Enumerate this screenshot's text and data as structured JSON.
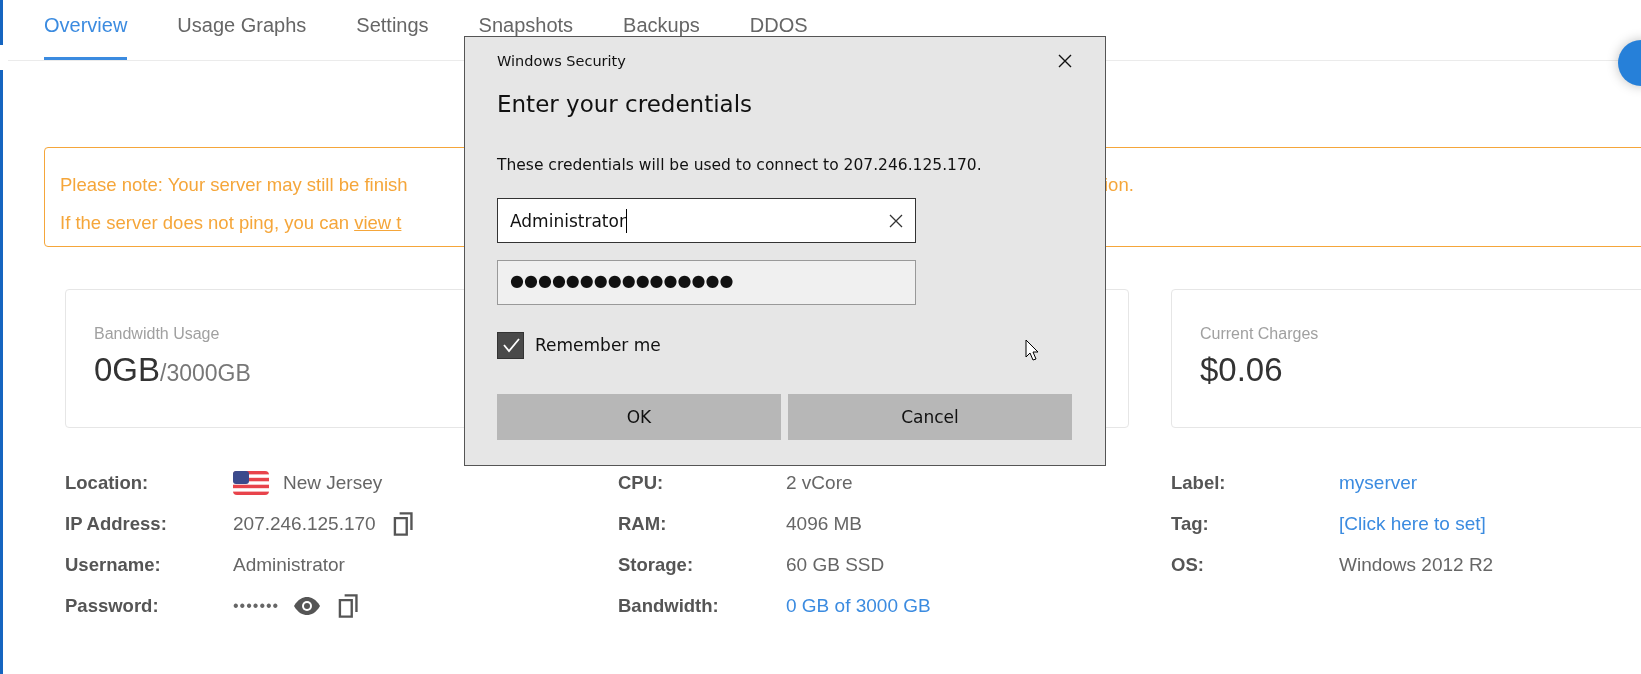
{
  "tabs": [
    {
      "label": "Overview",
      "selected": true
    },
    {
      "label": "Usage Graphs",
      "selected": false
    },
    {
      "label": "Settings",
      "selected": false
    },
    {
      "label": "Snapshots",
      "selected": false
    },
    {
      "label": "Backups",
      "selected": false
    },
    {
      "label": "DDOS",
      "selected": false
    }
  ],
  "notice": {
    "line_1": {
      "start": "Please note: Your server may still be finish",
      "end": "ion."
    },
    "line_2": {
      "text": "If the server does not ping, you can ",
      "link": "view t"
    }
  },
  "stat_cards": [
    {
      "label": "Bandwidth Usage",
      "value": "0GB",
      "unit": "/3000GB"
    },
    {
      "label": "Current Charges",
      "value": "$0.06"
    }
  ],
  "details": [
    [
      {
        "label": "Location:",
        "value": "New Jersey",
        "kind": "location"
      },
      {
        "label": "IP Address:",
        "value": "207.246.125.170",
        "kind": "copyable"
      },
      {
        "label": "Username:",
        "value": "Administrator",
        "kind": "text"
      },
      {
        "label": "Password:",
        "value": "•••••••",
        "kind": "secret"
      }
    ],
    [
      {
        "label": "CPU:",
        "value": "2 vCore",
        "kind": "text"
      },
      {
        "label": "RAM:",
        "value": "4096 MB",
        "kind": "text"
      },
      {
        "label": "Storage:",
        "value": "60 GB SSD",
        "kind": "text"
      },
      {
        "label": "Bandwidth:",
        "value": "0 GB of 3000 GB",
        "kind": "link"
      }
    ],
    [
      {
        "label": "Label:",
        "value": "myserver",
        "kind": "link"
      },
      {
        "label": "Tag:",
        "value": "[Click here to set]",
        "kind": "link"
      },
      {
        "label": "OS:",
        "value": "Windows 2012 R2",
        "kind": "text"
      }
    ]
  ],
  "dialog": {
    "title": "Windows Security",
    "heading": "Enter your credentials",
    "message": "These credentials will be used to connect to 207.246.125.170.",
    "username": {
      "value": "Administrator"
    },
    "password": {
      "value": "●●●●●●●●●●●●●●●●"
    },
    "remember": {
      "label": "Remember me",
      "checked": true
    },
    "buttons": [
      "OK",
      "Cancel"
    ]
  }
}
